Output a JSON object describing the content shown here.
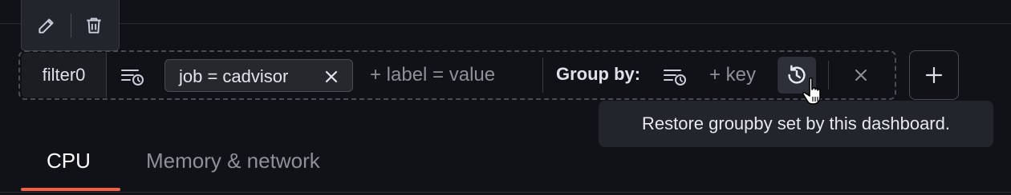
{
  "toolbar": {
    "edit_icon": "pencil-icon",
    "delete_icon": "trash-icon"
  },
  "filter": {
    "name": "filter0",
    "chip_text": "job = cadvisor",
    "label_placeholder": "+ label = value",
    "group_by_label": "Group by:",
    "key_placeholder": "+ key"
  },
  "tooltip": {
    "text": "Restore groupby set by this dashboard."
  },
  "tabs": [
    {
      "label": "CPU",
      "active": true
    },
    {
      "label": "Memory & network",
      "active": false
    }
  ],
  "colors": {
    "background": "#111217",
    "accent_underline": "#f55f3e",
    "border": "#4a4c55"
  }
}
